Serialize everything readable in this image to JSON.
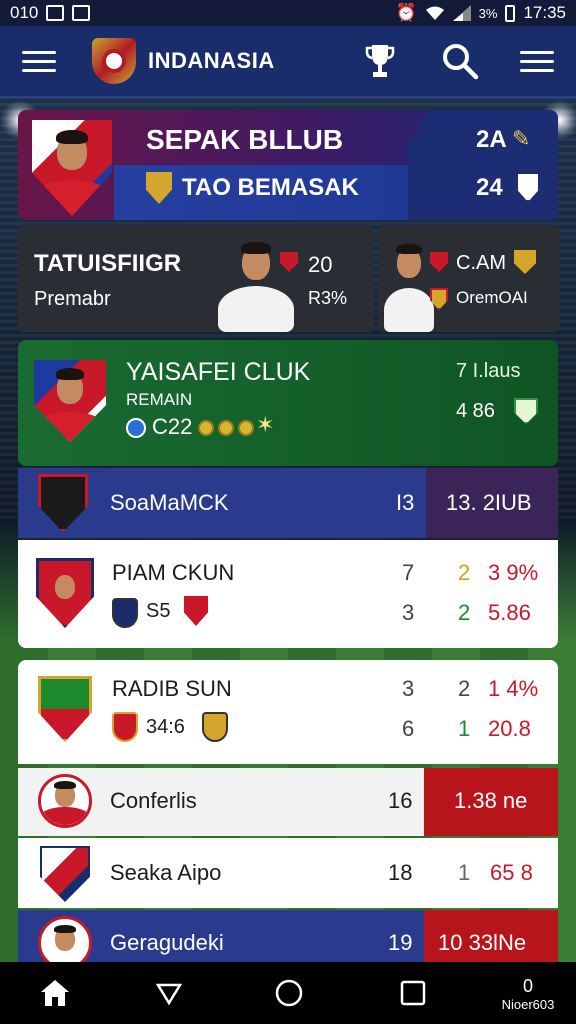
{
  "status_bar": {
    "left_text": "010",
    "time": "17:35",
    "battery": "3%"
  },
  "app_bar": {
    "title": "INDANASIA"
  },
  "hero_card": {
    "club_name": "SEPAK BLLUB",
    "subtitle": "TAO BEMASAK",
    "stat_top": "2A",
    "stat_bottom": "24"
  },
  "feature_card": {
    "title": "TATUISFIIGR",
    "subtitle": "Premabr",
    "player1_value": "20",
    "player1_percent": "R3%"
  },
  "side_card": {
    "label_top": "C.AM",
    "label_bottom": "OremOAI"
  },
  "green_card": {
    "club_name": "YAISAFEI CLUK",
    "sub": "REMAIN",
    "code": "C22",
    "stat_top": "7 I.laus",
    "stat_bottom": "4 86"
  },
  "header_row": {
    "label": "SoaMaMCK",
    "count": "I3",
    "value": "13. 2IUB"
  },
  "rows": [
    {
      "name": "PIAM CKUN",
      "sub": "S5",
      "a1": "7",
      "a2": "2",
      "a3": "3 9%",
      "b1": "3",
      "b2": "2",
      "b3": "5.86"
    },
    {
      "name": "RADIB SUN",
      "sub": "34:6",
      "a1": "3",
      "a2": "2",
      "a3": "1 4%",
      "b1": "6",
      "b2": "1",
      "b3": "20.8"
    }
  ],
  "list": [
    {
      "name": "Conferlis",
      "num": "16",
      "value": "1.38 ne"
    },
    {
      "name": "Seaka Aipo",
      "num": "18",
      "mid": "1",
      "value": "65 8"
    },
    {
      "name": "Geragudeki",
      "num": "19",
      "value": "10 33lNe"
    }
  ],
  "nav": {
    "extra_label": "Nioer603",
    "extra_icon_label": "0"
  },
  "colors": {
    "accent_blue": "#1a2d6b",
    "accent_red": "#b8141c",
    "green": "#1a6b32"
  }
}
